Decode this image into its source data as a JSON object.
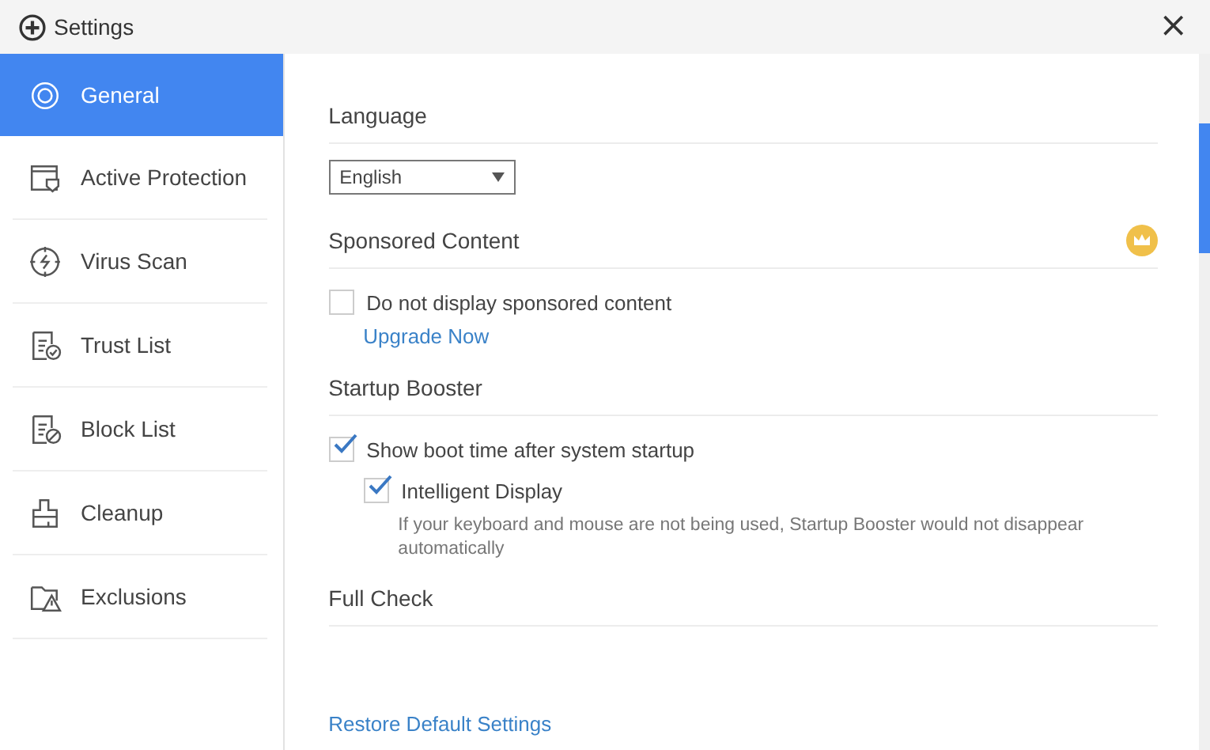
{
  "window": {
    "title": "Settings",
    "close": "×"
  },
  "sidebar": {
    "items": [
      {
        "label": "General",
        "selected": true
      },
      {
        "label": "Active Protection",
        "selected": false
      },
      {
        "label": "Virus Scan",
        "selected": false
      },
      {
        "label": "Trust List",
        "selected": false
      },
      {
        "label": "Block List",
        "selected": false
      },
      {
        "label": "Cleanup",
        "selected": false
      },
      {
        "label": "Exclusions",
        "selected": false
      }
    ]
  },
  "sections": [
    {
      "title": "Language",
      "premium": false,
      "controls": [
        {
          "kind": "dropdown",
          "value": "English"
        }
      ]
    },
    {
      "title": "Sponsored Content",
      "premium": true,
      "controls": [
        {
          "kind": "checkbox",
          "label": "Do not display sponsored content",
          "checked": false
        },
        {
          "kind": "link",
          "label": "Upgrade Now"
        }
      ]
    },
    {
      "title": "Startup Booster",
      "premium": false,
      "controls": [
        {
          "kind": "checkbox",
          "label": "Show boot time after system startup",
          "checked": true,
          "children": [
            {
              "kind": "checkbox",
              "label": "Intelligent Display",
              "checked": true,
              "note": "If your keyboard and mouse are not being used, Startup Booster would not disappear automatically"
            }
          ]
        }
      ]
    },
    {
      "title": "Full Check",
      "premium": false
    }
  ],
  "footer_link": "Restore Default Settings"
}
